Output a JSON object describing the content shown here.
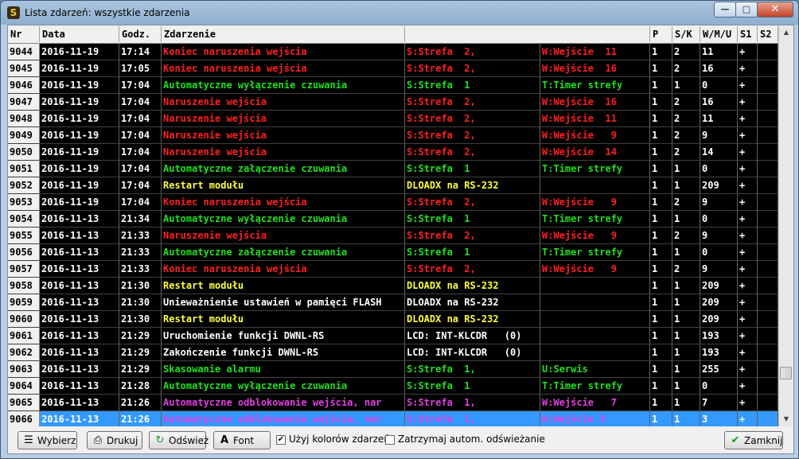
{
  "window": {
    "title": "Lista zdarzeń: wszystkie zdarzenia"
  },
  "columns": [
    "Nr",
    "Data",
    "Godz.",
    "Zdarzenie",
    "",
    "P",
    "S/K",
    "W/M/U",
    "S1",
    "S2"
  ],
  "colors": {
    "red": "#ff2020",
    "green": "#20e020",
    "yellow": "#ffff40",
    "white": "#ffffff",
    "magenta": "#e040e0",
    "selection": "#3399ff"
  },
  "rows": [
    {
      "nr": "9044",
      "date": "2016-11-19",
      "time": "17:14",
      "event": "Koniec naruszenia wejścia",
      "src": "S:Strefa  2,",
      "obj": "W:Wejście  11",
      "p": "1",
      "sk": "2",
      "wmu": "11",
      "s1": "+",
      "s2": "",
      "color": "red"
    },
    {
      "nr": "9045",
      "date": "2016-11-19",
      "time": "17:05",
      "event": "Koniec naruszenia wejścia",
      "src": "S:Strefa  2,",
      "obj": "W:Wejście  16",
      "p": "1",
      "sk": "2",
      "wmu": "16",
      "s1": "+",
      "s2": "",
      "color": "red"
    },
    {
      "nr": "9046",
      "date": "2016-11-19",
      "time": "17:04",
      "event": "Automatyczne wyłączenie czuwania",
      "src": "S:Strefa  1",
      "obj": "T:Timer strefy",
      "p": "1",
      "sk": "1",
      "wmu": "0",
      "s1": "+",
      "s2": "",
      "color": "green"
    },
    {
      "nr": "9047",
      "date": "2016-11-19",
      "time": "17:04",
      "event": "Naruszenie wejścia",
      "src": "S:Strefa  2,",
      "obj": "W:Wejście  16",
      "p": "1",
      "sk": "2",
      "wmu": "16",
      "s1": "+",
      "s2": "",
      "color": "red"
    },
    {
      "nr": "9048",
      "date": "2016-11-19",
      "time": "17:04",
      "event": "Naruszenie wejścia",
      "src": "S:Strefa  2,",
      "obj": "W:Wejście  11",
      "p": "1",
      "sk": "2",
      "wmu": "11",
      "s1": "+",
      "s2": "",
      "color": "red"
    },
    {
      "nr": "9049",
      "date": "2016-11-19",
      "time": "17:04",
      "event": "Naruszenie wejścia",
      "src": "S:Strefa  2,",
      "obj": "W:Wejście   9",
      "p": "1",
      "sk": "2",
      "wmu": "9",
      "s1": "+",
      "s2": "",
      "color": "red"
    },
    {
      "nr": "9050",
      "date": "2016-11-19",
      "time": "17:04",
      "event": "Naruszenie wejścia",
      "src": "S:Strefa  2,",
      "obj": "W:Wejście  14",
      "p": "1",
      "sk": "2",
      "wmu": "14",
      "s1": "+",
      "s2": "",
      "color": "red"
    },
    {
      "nr": "9051",
      "date": "2016-11-19",
      "time": "17:04",
      "event": "Automatyczne załączenie czuwania",
      "src": "S:Strefa  1",
      "obj": "T:Timer strefy",
      "p": "1",
      "sk": "1",
      "wmu": "0",
      "s1": "+",
      "s2": "",
      "color": "green"
    },
    {
      "nr": "9052",
      "date": "2016-11-19",
      "time": "17:04",
      "event": "Restart modułu",
      "src": "DLOADX na RS-232",
      "obj": "",
      "p": "1",
      "sk": "1",
      "wmu": "209",
      "s1": "+",
      "s2": "",
      "color": "yellow"
    },
    {
      "nr": "9053",
      "date": "2016-11-19",
      "time": "17:04",
      "event": "Koniec naruszenia wejścia",
      "src": "S:Strefa  2,",
      "obj": "W:Wejście   9",
      "p": "1",
      "sk": "2",
      "wmu": "9",
      "s1": "+",
      "s2": "",
      "color": "red"
    },
    {
      "nr": "9054",
      "date": "2016-11-13",
      "time": "21:34",
      "event": "Automatyczne wyłączenie czuwania",
      "src": "S:Strefa  1",
      "obj": "T:Timer strefy",
      "p": "1",
      "sk": "1",
      "wmu": "0",
      "s1": "+",
      "s2": "",
      "color": "green"
    },
    {
      "nr": "9055",
      "date": "2016-11-13",
      "time": "21:33",
      "event": "Naruszenie wejścia",
      "src": "S:Strefa  2,",
      "obj": "W:Wejście   9",
      "p": "1",
      "sk": "2",
      "wmu": "9",
      "s1": "+",
      "s2": "",
      "color": "red"
    },
    {
      "nr": "9056",
      "date": "2016-11-13",
      "time": "21:33",
      "event": "Automatyczne załączenie czuwania",
      "src": "S:Strefa  1",
      "obj": "T:Timer strefy",
      "p": "1",
      "sk": "1",
      "wmu": "0",
      "s1": "+",
      "s2": "",
      "color": "green"
    },
    {
      "nr": "9057",
      "date": "2016-11-13",
      "time": "21:33",
      "event": "Koniec naruszenia wejścia",
      "src": "S:Strefa  2,",
      "obj": "W:Wejście   9",
      "p": "1",
      "sk": "2",
      "wmu": "9",
      "s1": "+",
      "s2": "",
      "color": "red"
    },
    {
      "nr": "9058",
      "date": "2016-11-13",
      "time": "21:30",
      "event": "Restart modułu",
      "src": "DLOADX na RS-232",
      "obj": "",
      "p": "1",
      "sk": "1",
      "wmu": "209",
      "s1": "+",
      "s2": "",
      "color": "yellow"
    },
    {
      "nr": "9059",
      "date": "2016-11-13",
      "time": "21:30",
      "event": "Unieważnienie ustawień w pamięci FLASH",
      "src": "DLOADX na RS-232",
      "obj": "",
      "p": "1",
      "sk": "1",
      "wmu": "209",
      "s1": "+",
      "s2": "",
      "color": "white"
    },
    {
      "nr": "9060",
      "date": "2016-11-13",
      "time": "21:30",
      "event": "Restart modułu",
      "src": "DLOADX na RS-232",
      "obj": "",
      "p": "1",
      "sk": "1",
      "wmu": "209",
      "s1": "+",
      "s2": "",
      "color": "yellow"
    },
    {
      "nr": "9061",
      "date": "2016-11-13",
      "time": "21:29",
      "event": "Uruchomienie funkcji DWNL-RS",
      "src": "LCD: INT-KLCDR   (0)",
      "obj": "",
      "p": "1",
      "sk": "1",
      "wmu": "193",
      "s1": "+",
      "s2": "",
      "color": "white"
    },
    {
      "nr": "9062",
      "date": "2016-11-13",
      "time": "21:29",
      "event": "Zakończenie funkcji DWNL-RS",
      "src": "LCD: INT-KLCDR   (0)",
      "obj": "",
      "p": "1",
      "sk": "1",
      "wmu": "193",
      "s1": "+",
      "s2": "",
      "color": "white"
    },
    {
      "nr": "9063",
      "date": "2016-11-13",
      "time": "21:29",
      "event": "Skasowanie alarmu",
      "src": "S:Strefa  1,",
      "obj": "U:Serwis",
      "p": "1",
      "sk": "1",
      "wmu": "255",
      "s1": "+",
      "s2": "",
      "color": "green"
    },
    {
      "nr": "9064",
      "date": "2016-11-13",
      "time": "21:28",
      "event": "Automatyczne wyłączenie czuwania",
      "src": "S:Strefa  1",
      "obj": "T:Timer strefy",
      "p": "1",
      "sk": "1",
      "wmu": "0",
      "s1": "+",
      "s2": "",
      "color": "green"
    },
    {
      "nr": "9065",
      "date": "2016-11-13",
      "time": "21:26",
      "event": "Automatyczne odblokowanie wejścia, nar",
      "src": "S:Strefa  1,",
      "obj": "W:Wejście   7",
      "p": "1",
      "sk": "1",
      "wmu": "7",
      "s1": "+",
      "s2": "",
      "color": "magenta"
    },
    {
      "nr": "9066",
      "date": "2016-11-13",
      "time": "21:26",
      "event": "Automatyczne odblokowanie wejścia, nar",
      "src": "S:Strefa  1,",
      "obj": "W:Wejście 3",
      "p": "1",
      "sk": "1",
      "wmu": "3",
      "s1": "+",
      "s2": "",
      "color": "magenta",
      "selected": true
    }
  ],
  "toolbar": {
    "select_label": "Wybierz",
    "print_label": "Drukuj",
    "refresh_label": "Odśwież",
    "font_label": "Font",
    "use_colors_label": "Użyj kolorów zdarzeń",
    "use_colors_checked": true,
    "stop_refresh_label": "Zatrzymaj autom. odświeżanie",
    "stop_refresh_checked": false,
    "close_label": "Zamknij"
  }
}
